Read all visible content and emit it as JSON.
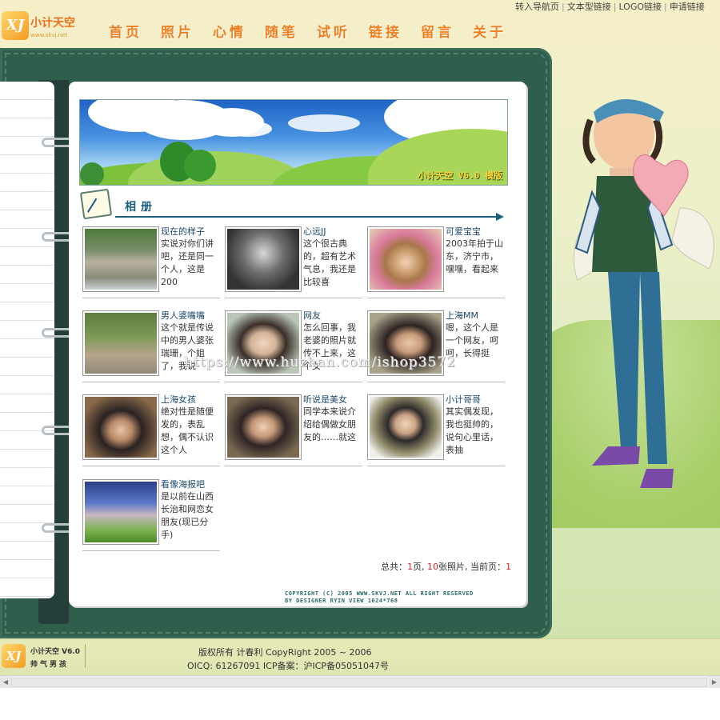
{
  "site": {
    "logo_badge": "XJ",
    "logo_name": "小计天空",
    "logo_url": "www.skvj.net",
    "top_links": [
      "转入导航页",
      "文本型链接",
      "LOGO链接",
      "申请链接"
    ],
    "nav": [
      "首页",
      "照片",
      "心情",
      "随笔",
      "试听",
      "链接",
      "留言",
      "关于"
    ]
  },
  "banner": {
    "caption": "小计天空 V6.0 模版"
  },
  "section": {
    "title": "相册"
  },
  "gallery": [
    {
      "title": "现在的样子",
      "desc": "实说对你们讲吧，还是同一个人，这是200"
    },
    {
      "title": "心远JJ",
      "desc": "这个很古典的，超有艺术气息，我还是比较喜"
    },
    {
      "title": "可爱宝宝",
      "desc": "2003年拍于山东，济宁市，嘿嘿，看起来"
    },
    {
      "title": "男人婆嘴嘴",
      "desc": "这个就是传说中的男人婆张瑞珊，个姐了，我说"
    },
    {
      "title": "网友",
      "desc": "怎么回事，我老婆的照片就传不上来，这个女"
    },
    {
      "title": "上海MM",
      "desc": "嗯，这个人是一个网友，呵呵，长得挺"
    },
    {
      "title": "上海女孩",
      "desc": "绝对性是随便发的，表乱想，偶不认识这个人"
    },
    {
      "title": "听说是美女",
      "desc": "同学本来说介绍给偶做女朋友的……就这"
    },
    {
      "title": "小计哥哥",
      "desc": "其实偶发现，我也挺帅的，说句心里话，表抽"
    },
    {
      "title": "看像海报吧",
      "desc": "是以前在山西长治和网恋女朋友(现已分手)"
    }
  ],
  "pager": {
    "label_total": "总共：",
    "total_pages": "1",
    "label_pages": "页, ",
    "total_photos": "10",
    "label_photos": "张照片, 当前页：",
    "current": "1"
  },
  "copyright": {
    "line1": "COPYRIGHT (C) 2005 WWW.SKVJ.NET ALL RIGHT RESERVED",
    "line2": "BY DESIGNER RYIN VIEW 1024*768"
  },
  "footer": {
    "logo_line1": "小计天空 V6.0",
    "logo_line2": "帅气男孩",
    "line1": "版权所有 计春利 CopyRight 2005 ~ 2006",
    "line2": "OICQ: 61267091 ICP备案：沪ICP备05051047号"
  },
  "watermark": "https://www.huzhan.com/ishop3572",
  "colors": {
    "nav": "#f07f1e",
    "binder": "#2f5e4d",
    "title": "#1a5f7f",
    "page_num": "#dd2222"
  },
  "icons": [
    "album-pen-icon",
    "arrow-right-icon",
    "ring-icon"
  ]
}
